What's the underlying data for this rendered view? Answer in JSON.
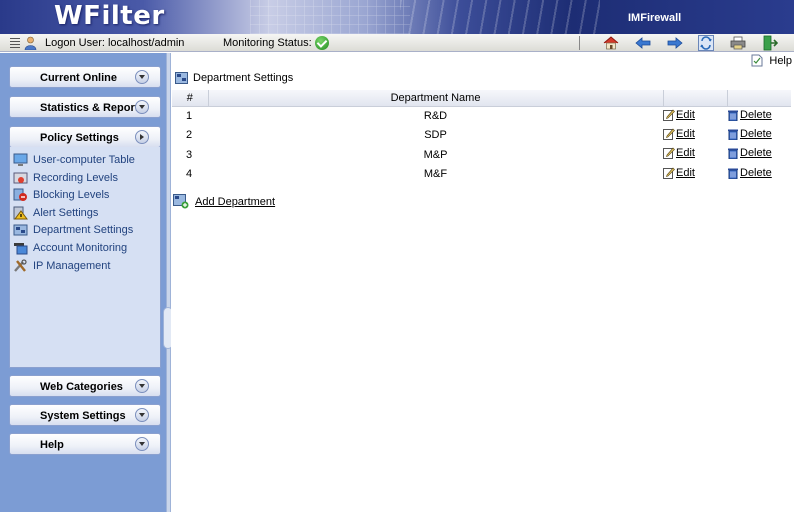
{
  "banner": {
    "logo": "WFilter",
    "product": "IMFirewall"
  },
  "statusbar": {
    "logon_user": "Logon User: localhost/admin",
    "monitoring_status": "Monitoring Status:",
    "toolbar_icons": [
      "home-icon",
      "back-arrow-icon",
      "forward-arrow-icon",
      "refresh-icon",
      "print-icon",
      "logout-icon"
    ]
  },
  "sidebar": {
    "sections": [
      {
        "label": "Current Online"
      },
      {
        "label": "Statistics & Reports"
      },
      {
        "label": "Policy Settings"
      },
      {
        "label": "Web Categories"
      },
      {
        "label": "System Settings"
      },
      {
        "label": "Help"
      }
    ],
    "policy_items": [
      {
        "label": "User-computer Table",
        "icon": "monitor-icon"
      },
      {
        "label": "Recording Levels",
        "icon": "recording-icon"
      },
      {
        "label": "Blocking Levels",
        "icon": "blocking-icon"
      },
      {
        "label": "Alert Settings",
        "icon": "alert-icon"
      },
      {
        "label": "Department Settings",
        "icon": "department-icon"
      },
      {
        "label": "Account Monitoring",
        "icon": "account-monitor-icon"
      },
      {
        "label": "IP Management",
        "icon": "tools-icon"
      }
    ]
  },
  "content": {
    "help_label": "Help",
    "page_title": "Department Settings",
    "table": {
      "columns": [
        "#",
        "Department Name",
        "",
        ""
      ],
      "rows": [
        {
          "num": "1",
          "name": "R&D"
        },
        {
          "num": "2",
          "name": "SDP"
        },
        {
          "num": "3",
          "name": "M&P"
        },
        {
          "num": "4",
          "name": "M&F"
        }
      ],
      "edit_label": "Edit",
      "delete_label": "Delete"
    },
    "add_label": "Add Department"
  },
  "colors": {
    "sidebar_bg": "#7c9cd4",
    "nav_text": "#22437f",
    "status_ok": "#2e9a2e",
    "banner": "#2a3c8e"
  }
}
